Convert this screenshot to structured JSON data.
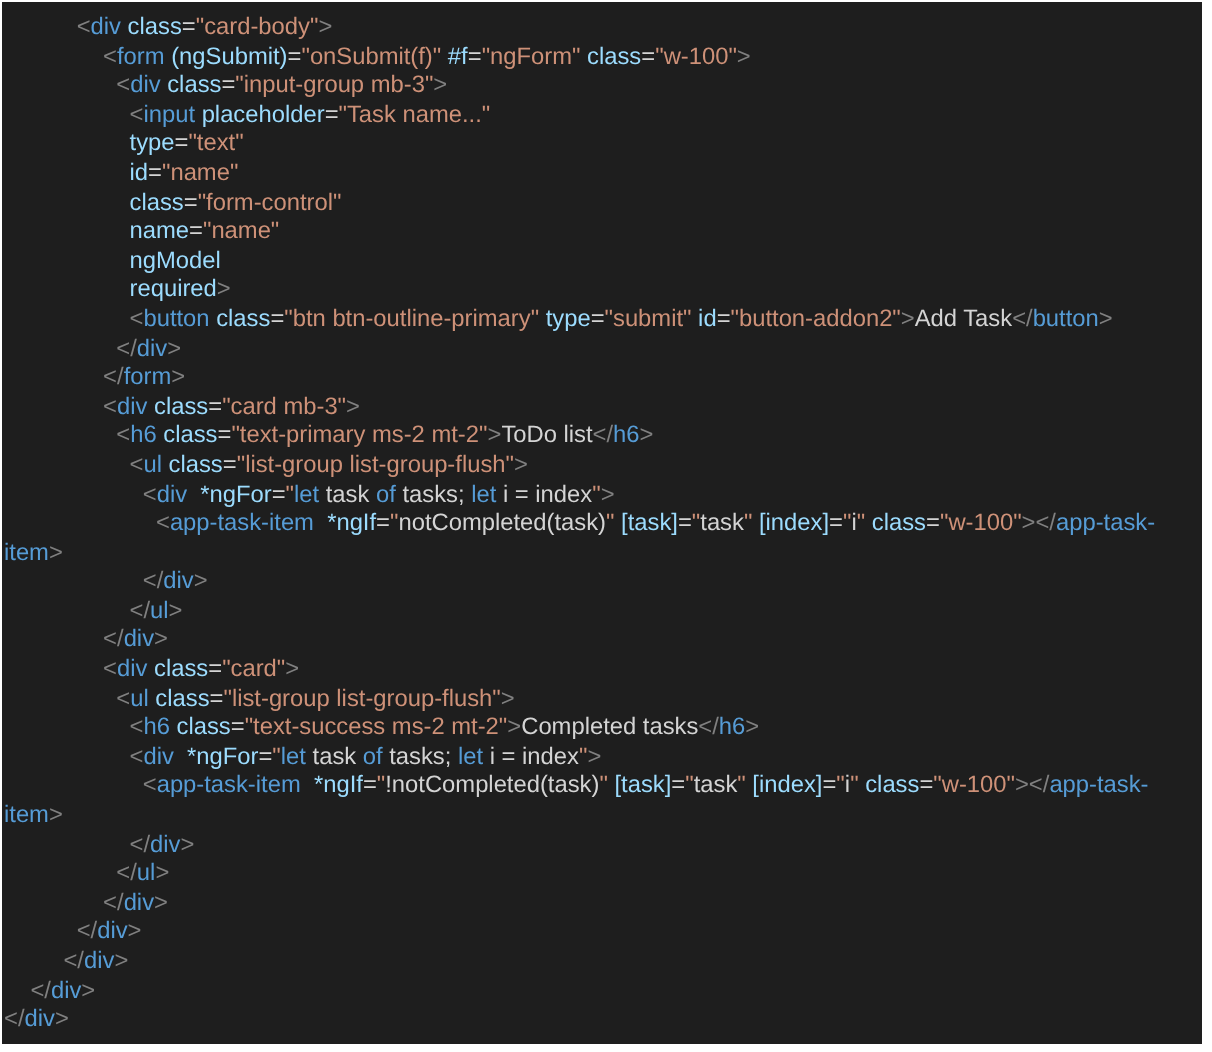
{
  "editor": {
    "lines": [
      [
        {
          "kind": "punct",
          "text": "           <"
        },
        {
          "kind": "tag",
          "text": "div"
        },
        {
          "kind": "attr",
          "text": " class"
        },
        {
          "kind": "text",
          "text": "="
        },
        {
          "kind": "string",
          "text": "\"card-body\""
        },
        {
          "kind": "punct",
          "text": ">"
        }
      ],
      [
        {
          "kind": "punct",
          "text": "               <"
        },
        {
          "kind": "tag",
          "text": "form"
        },
        {
          "kind": "attr",
          "text": " (ngSubmit)"
        },
        {
          "kind": "text",
          "text": "="
        },
        {
          "kind": "string",
          "text": "\"onSubmit(f)\""
        },
        {
          "kind": "attr",
          "text": " #f"
        },
        {
          "kind": "text",
          "text": "="
        },
        {
          "kind": "string",
          "text": "\"ngForm\""
        },
        {
          "kind": "attr",
          "text": " class"
        },
        {
          "kind": "text",
          "text": "="
        },
        {
          "kind": "string",
          "text": "\"w-100\""
        },
        {
          "kind": "punct",
          "text": ">"
        }
      ],
      [
        {
          "kind": "punct",
          "text": "                 <"
        },
        {
          "kind": "tag",
          "text": "div"
        },
        {
          "kind": "attr",
          "text": " class"
        },
        {
          "kind": "text",
          "text": "="
        },
        {
          "kind": "string",
          "text": "\"input-group mb-3\""
        },
        {
          "kind": "punct",
          "text": ">"
        }
      ],
      [
        {
          "kind": "punct",
          "text": "                   <"
        },
        {
          "kind": "tag",
          "text": "input"
        },
        {
          "kind": "attr",
          "text": " placeholder"
        },
        {
          "kind": "text",
          "text": "="
        },
        {
          "kind": "string",
          "text": "\"Task name...\""
        }
      ],
      [
        {
          "kind": "attr",
          "text": "                   type"
        },
        {
          "kind": "text",
          "text": "="
        },
        {
          "kind": "string",
          "text": "\"text\""
        }
      ],
      [
        {
          "kind": "attr",
          "text": "                   id"
        },
        {
          "kind": "text",
          "text": "="
        },
        {
          "kind": "string",
          "text": "\"name\""
        }
      ],
      [
        {
          "kind": "attr",
          "text": "                   class"
        },
        {
          "kind": "text",
          "text": "="
        },
        {
          "kind": "string",
          "text": "\"form-control\""
        }
      ],
      [
        {
          "kind": "attr",
          "text": "                   name"
        },
        {
          "kind": "text",
          "text": "="
        },
        {
          "kind": "string",
          "text": "\"name\""
        }
      ],
      [
        {
          "kind": "attr",
          "text": "                   ngModel"
        }
      ],
      [
        {
          "kind": "attr",
          "text": "                   required"
        },
        {
          "kind": "punct",
          "text": ">"
        }
      ],
      [
        {
          "kind": "punct",
          "text": "                   <"
        },
        {
          "kind": "tag",
          "text": "button"
        },
        {
          "kind": "attr",
          "text": " class"
        },
        {
          "kind": "text",
          "text": "="
        },
        {
          "kind": "string",
          "text": "\"btn btn-outline-primary\""
        },
        {
          "kind": "attr",
          "text": " type"
        },
        {
          "kind": "text",
          "text": "="
        },
        {
          "kind": "string",
          "text": "\"submit\""
        },
        {
          "kind": "attr",
          "text": " id"
        },
        {
          "kind": "text",
          "text": "="
        },
        {
          "kind": "string",
          "text": "\"button-addon2\""
        },
        {
          "kind": "punct",
          "text": ">"
        },
        {
          "kind": "text",
          "text": "Add Task"
        },
        {
          "kind": "punct",
          "text": "</"
        },
        {
          "kind": "tag",
          "text": "button"
        },
        {
          "kind": "punct",
          "text": ">"
        }
      ],
      [
        {
          "kind": "punct",
          "text": "                 </"
        },
        {
          "kind": "tag",
          "text": "div"
        },
        {
          "kind": "punct",
          "text": ">"
        }
      ],
      [
        {
          "kind": "punct",
          "text": "               </"
        },
        {
          "kind": "tag",
          "text": "form"
        },
        {
          "kind": "punct",
          "text": ">"
        }
      ],
      [
        {
          "kind": "punct",
          "text": "               <"
        },
        {
          "kind": "tag",
          "text": "div"
        },
        {
          "kind": "attr",
          "text": " class"
        },
        {
          "kind": "text",
          "text": "="
        },
        {
          "kind": "string",
          "text": "\"card mb-3\""
        },
        {
          "kind": "punct",
          "text": ">"
        }
      ],
      [
        {
          "kind": "punct",
          "text": "                 <"
        },
        {
          "kind": "tag",
          "text": "h6"
        },
        {
          "kind": "attr",
          "text": " class"
        },
        {
          "kind": "text",
          "text": "="
        },
        {
          "kind": "string",
          "text": "\"text-primary ms-2 mt-2\""
        },
        {
          "kind": "punct",
          "text": ">"
        },
        {
          "kind": "text",
          "text": "ToDo list"
        },
        {
          "kind": "punct",
          "text": "</"
        },
        {
          "kind": "tag",
          "text": "h6"
        },
        {
          "kind": "punct",
          "text": ">"
        }
      ],
      [
        {
          "kind": "punct",
          "text": "                   <"
        },
        {
          "kind": "tag",
          "text": "ul"
        },
        {
          "kind": "attr",
          "text": " class"
        },
        {
          "kind": "text",
          "text": "="
        },
        {
          "kind": "string",
          "text": "\"list-group list-group-flush\""
        },
        {
          "kind": "punct",
          "text": ">"
        }
      ],
      [
        {
          "kind": "punct",
          "text": "                     <"
        },
        {
          "kind": "tag",
          "text": "div"
        },
        {
          "kind": "attr",
          "text": "  *ngFor"
        },
        {
          "kind": "text",
          "text": "="
        },
        {
          "kind": "string",
          "text": "\""
        },
        {
          "kind": "keyword",
          "text": "let"
        },
        {
          "kind": "text",
          "text": " task "
        },
        {
          "kind": "keyword",
          "text": "of"
        },
        {
          "kind": "text",
          "text": " tasks; "
        },
        {
          "kind": "keyword",
          "text": "let"
        },
        {
          "kind": "text",
          "text": " i = index"
        },
        {
          "kind": "string",
          "text": "\""
        },
        {
          "kind": "punct",
          "text": ">"
        }
      ],
      [
        {
          "kind": "punct",
          "text": "                       <"
        },
        {
          "kind": "tag",
          "text": "app-task-item"
        },
        {
          "kind": "attr",
          "text": "  *ngIf"
        },
        {
          "kind": "text",
          "text": "="
        },
        {
          "kind": "string",
          "text": "\""
        },
        {
          "kind": "text",
          "text": "notCompleted(task)"
        },
        {
          "kind": "string",
          "text": "\""
        },
        {
          "kind": "attr",
          "text": " [task]"
        },
        {
          "kind": "text",
          "text": "="
        },
        {
          "kind": "string",
          "text": "\""
        },
        {
          "kind": "text",
          "text": "task"
        },
        {
          "kind": "string",
          "text": "\""
        },
        {
          "kind": "attr",
          "text": " [index]"
        },
        {
          "kind": "text",
          "text": "="
        },
        {
          "kind": "string",
          "text": "\""
        },
        {
          "kind": "text",
          "text": "i"
        },
        {
          "kind": "string",
          "text": "\""
        },
        {
          "kind": "attr",
          "text": " class"
        },
        {
          "kind": "text",
          "text": "="
        },
        {
          "kind": "string",
          "text": "\"w-100\""
        },
        {
          "kind": "punct",
          "text": "></"
        },
        {
          "kind": "tag",
          "text": "app-task-"
        }
      ],
      [
        {
          "kind": "tag",
          "text": "item"
        },
        {
          "kind": "punct",
          "text": ">"
        }
      ],
      [
        {
          "kind": "punct",
          "text": "                     </"
        },
        {
          "kind": "tag",
          "text": "div"
        },
        {
          "kind": "punct",
          "text": ">"
        }
      ],
      [
        {
          "kind": "punct",
          "text": "                   </"
        },
        {
          "kind": "tag",
          "text": "ul"
        },
        {
          "kind": "punct",
          "text": ">"
        }
      ],
      [
        {
          "kind": "punct",
          "text": "               </"
        },
        {
          "kind": "tag",
          "text": "div"
        },
        {
          "kind": "punct",
          "text": ">"
        }
      ],
      [
        {
          "kind": "punct",
          "text": "               <"
        },
        {
          "kind": "tag",
          "text": "div"
        },
        {
          "kind": "attr",
          "text": " class"
        },
        {
          "kind": "text",
          "text": "="
        },
        {
          "kind": "string",
          "text": "\"card\""
        },
        {
          "kind": "punct",
          "text": ">"
        }
      ],
      [
        {
          "kind": "punct",
          "text": "                 <"
        },
        {
          "kind": "tag",
          "text": "ul"
        },
        {
          "kind": "attr",
          "text": " class"
        },
        {
          "kind": "text",
          "text": "="
        },
        {
          "kind": "string",
          "text": "\"list-group list-group-flush\""
        },
        {
          "kind": "punct",
          "text": ">"
        }
      ],
      [
        {
          "kind": "punct",
          "text": "                   <"
        },
        {
          "kind": "tag",
          "text": "h6"
        },
        {
          "kind": "attr",
          "text": " class"
        },
        {
          "kind": "text",
          "text": "="
        },
        {
          "kind": "string",
          "text": "\"text-success ms-2 mt-2\""
        },
        {
          "kind": "punct",
          "text": ">"
        },
        {
          "kind": "text",
          "text": "Completed tasks"
        },
        {
          "kind": "punct",
          "text": "</"
        },
        {
          "kind": "tag",
          "text": "h6"
        },
        {
          "kind": "punct",
          "text": ">"
        }
      ],
      [
        {
          "kind": "punct",
          "text": "                   <"
        },
        {
          "kind": "tag",
          "text": "div"
        },
        {
          "kind": "attr",
          "text": "  *ngFor"
        },
        {
          "kind": "text",
          "text": "="
        },
        {
          "kind": "string",
          "text": "\""
        },
        {
          "kind": "keyword",
          "text": "let"
        },
        {
          "kind": "text",
          "text": " task "
        },
        {
          "kind": "keyword",
          "text": "of"
        },
        {
          "kind": "text",
          "text": " tasks; "
        },
        {
          "kind": "keyword",
          "text": "let"
        },
        {
          "kind": "text",
          "text": " i = index"
        },
        {
          "kind": "string",
          "text": "\""
        },
        {
          "kind": "punct",
          "text": ">"
        }
      ],
      [
        {
          "kind": "punct",
          "text": "                     <"
        },
        {
          "kind": "tag",
          "text": "app-task-item"
        },
        {
          "kind": "attr",
          "text": "  *ngIf"
        },
        {
          "kind": "text",
          "text": "="
        },
        {
          "kind": "string",
          "text": "\""
        },
        {
          "kind": "text",
          "text": "!notCompleted(task)"
        },
        {
          "kind": "string",
          "text": "\""
        },
        {
          "kind": "attr",
          "text": " [task]"
        },
        {
          "kind": "text",
          "text": "="
        },
        {
          "kind": "string",
          "text": "\""
        },
        {
          "kind": "text",
          "text": "task"
        },
        {
          "kind": "string",
          "text": "\""
        },
        {
          "kind": "attr",
          "text": " [index]"
        },
        {
          "kind": "text",
          "text": "="
        },
        {
          "kind": "string",
          "text": "\""
        },
        {
          "kind": "text",
          "text": "i"
        },
        {
          "kind": "string",
          "text": "\""
        },
        {
          "kind": "attr",
          "text": " class"
        },
        {
          "kind": "text",
          "text": "="
        },
        {
          "kind": "string",
          "text": "\"w-100\""
        },
        {
          "kind": "punct",
          "text": "></"
        },
        {
          "kind": "tag",
          "text": "app-task-"
        }
      ],
      [
        {
          "kind": "tag",
          "text": "item"
        },
        {
          "kind": "punct",
          "text": ">"
        }
      ],
      [
        {
          "kind": "punct",
          "text": "                   </"
        },
        {
          "kind": "tag",
          "text": "div"
        },
        {
          "kind": "punct",
          "text": ">"
        }
      ],
      [
        {
          "kind": "punct",
          "text": "                 </"
        },
        {
          "kind": "tag",
          "text": "ul"
        },
        {
          "kind": "punct",
          "text": ">"
        }
      ],
      [
        {
          "kind": "punct",
          "text": "               </"
        },
        {
          "kind": "tag",
          "text": "div"
        },
        {
          "kind": "punct",
          "text": ">"
        }
      ],
      [
        {
          "kind": "punct",
          "text": "           </"
        },
        {
          "kind": "tag",
          "text": "div"
        },
        {
          "kind": "punct",
          "text": ">"
        }
      ],
      [
        {
          "kind": "punct",
          "text": "         </"
        },
        {
          "kind": "tag",
          "text": "div"
        },
        {
          "kind": "punct",
          "text": ">"
        }
      ],
      [
        {
          "kind": "punct",
          "text": "    </"
        },
        {
          "kind": "tag",
          "text": "div"
        },
        {
          "kind": "punct",
          "text": ">"
        }
      ],
      [
        {
          "kind": "punct",
          "text": "</"
        },
        {
          "kind": "tag",
          "text": "div"
        },
        {
          "kind": "punct",
          "text": ">"
        }
      ]
    ]
  }
}
